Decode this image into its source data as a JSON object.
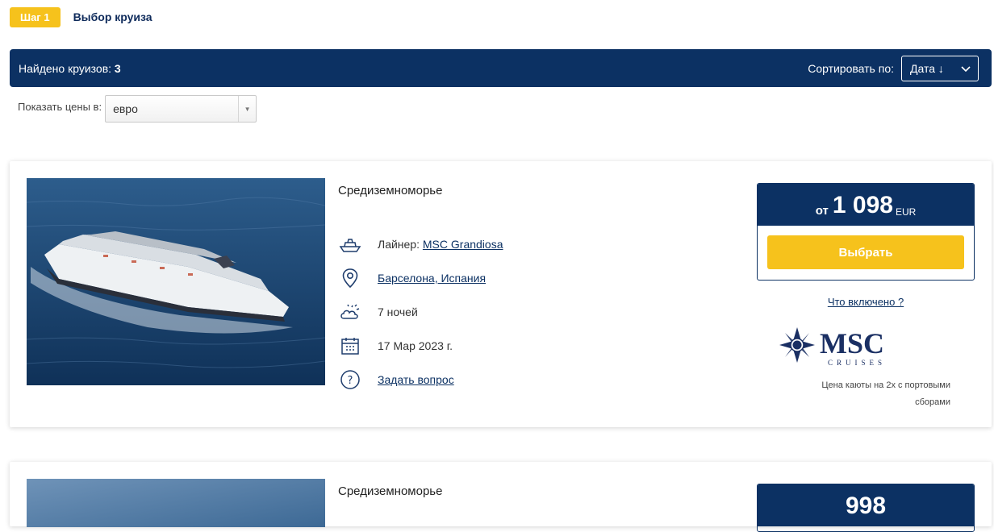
{
  "step": {
    "badge": "Шаг 1",
    "title": "Выбор круиза"
  },
  "results": {
    "found_label": "Найдено круизов:",
    "found_count": "3",
    "sort_label": "Сортировать по:",
    "sort_value": "Дата ↓"
  },
  "currency": {
    "label": "Показать цены в:",
    "value": "евро"
  },
  "cruises": [
    {
      "region": "Средиземноморье",
      "ship_label": "Лайнер:",
      "ship_name": "MSC Grandiosa",
      "port": "Барселона, Испания",
      "nights": "7 ночей",
      "date": "17 Мар 2023 г.",
      "ask": "Задать вопрос",
      "price_from": "от",
      "price": "1 098",
      "price_currency": "EUR",
      "select_label": "Выбрать",
      "included": "Что включено ?",
      "brand": "MSC",
      "brand_sub": "CRUISES",
      "note": "Цена каюты на 2х с портовыми сборами"
    },
    {
      "region": "Средиземноморье",
      "price": "998"
    }
  ],
  "colors": {
    "navy": "#0c3163",
    "yellow": "#f6c21c"
  }
}
